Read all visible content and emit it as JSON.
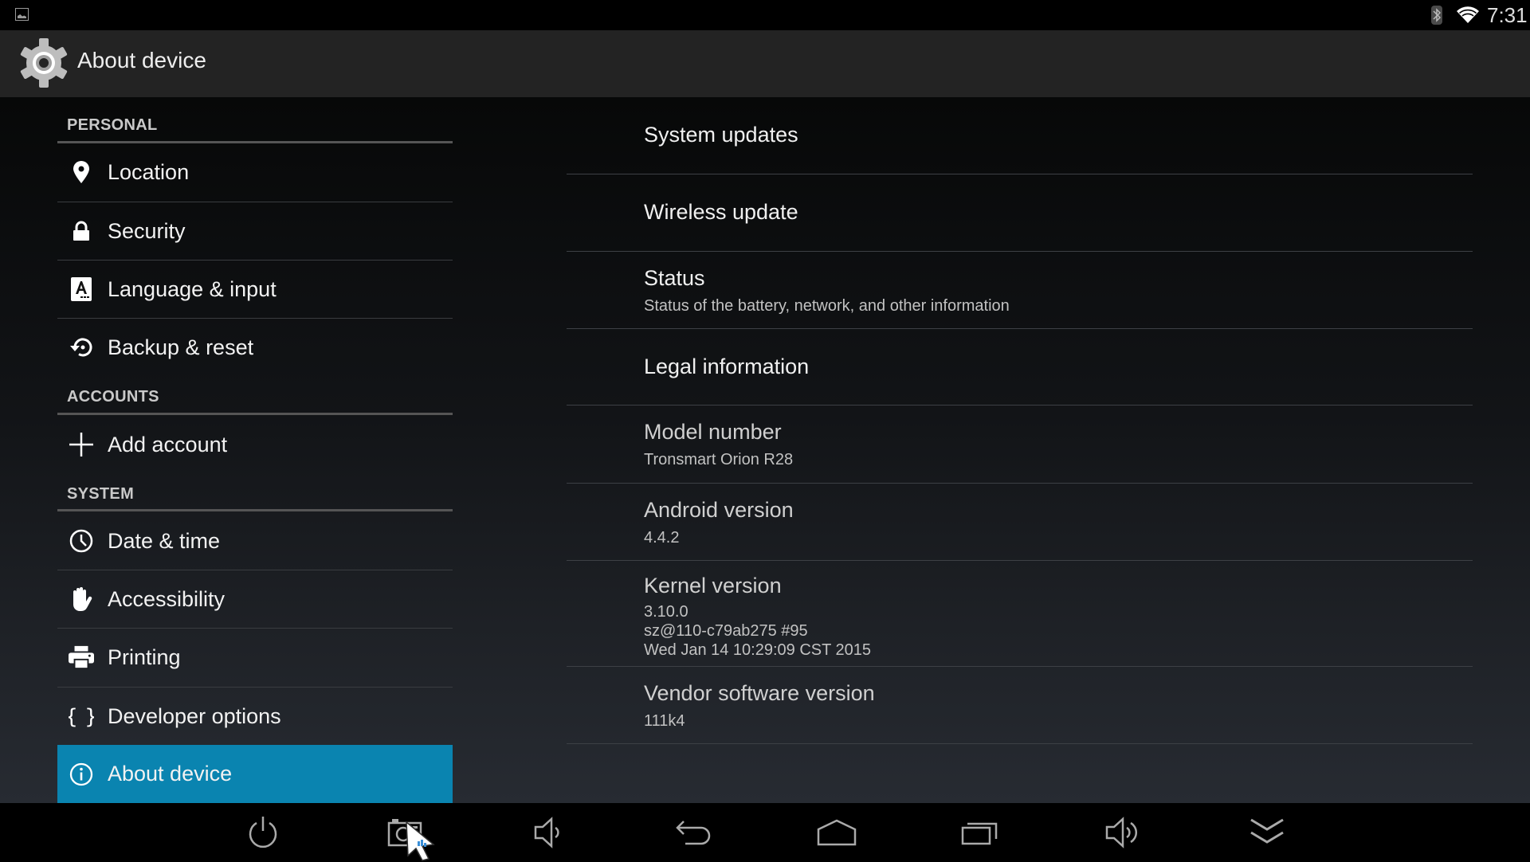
{
  "status_bar": {
    "notification_icon": "gallery-icon",
    "bluetooth_icon": "bluetooth-icon",
    "wifi_icon": "wifi-icon",
    "time": "7:31"
  },
  "action_bar": {
    "icon": "settings-gear-icon",
    "title": "About device"
  },
  "sidebar": {
    "categories": [
      {
        "label": "PERSONAL"
      },
      {
        "label": "ACCOUNTS"
      },
      {
        "label": "SYSTEM"
      }
    ],
    "items": [
      {
        "label": "Location",
        "icon": "location-pin-icon"
      },
      {
        "label": "Security",
        "icon": "lock-icon"
      },
      {
        "label": "Language & input",
        "icon": "language-keyboard-icon"
      },
      {
        "label": "Backup & reset",
        "icon": "backup-restore-icon"
      },
      {
        "label": "Add account",
        "icon": "plus-icon"
      },
      {
        "label": "Date & time",
        "icon": "clock-icon"
      },
      {
        "label": "Accessibility",
        "icon": "hand-icon"
      },
      {
        "label": "Printing",
        "icon": "printer-icon"
      },
      {
        "label": "Developer options",
        "icon": "braces-icon"
      },
      {
        "label": "About device",
        "icon": "info-icon",
        "selected": true
      }
    ],
    "selected_color": "#0a84b0"
  },
  "details": {
    "rows": [
      {
        "title": "System updates"
      },
      {
        "title": "Wireless update"
      },
      {
        "title": "Status",
        "summary": "Status of the battery, network, and other information"
      },
      {
        "title": "Legal information"
      },
      {
        "title": "Model number",
        "summary": "Tronsmart Orion R28"
      },
      {
        "title": "Android version",
        "summary": "4.4.2"
      },
      {
        "title": "Kernel version",
        "summary_lines": [
          "3.10.0",
          "sz@110-c79ab275 #95",
          "Wed Jan 14 10:29:09 CST 2015"
        ]
      },
      {
        "title": "Vendor software version",
        "summary": "111k4"
      }
    ]
  },
  "nav_bar": {
    "buttons": [
      {
        "name": "power",
        "icon": "power-icon"
      },
      {
        "name": "screenshot",
        "icon": "camera-icon"
      },
      {
        "name": "volume-down",
        "icon": "volume-down-icon"
      },
      {
        "name": "back",
        "icon": "back-arrow-icon"
      },
      {
        "name": "home",
        "icon": "home-icon"
      },
      {
        "name": "recent-apps",
        "icon": "recent-apps-icon"
      },
      {
        "name": "volume-up",
        "icon": "volume-up-icon"
      },
      {
        "name": "hide-bar",
        "icon": "double-chevron-down-icon"
      }
    ]
  }
}
